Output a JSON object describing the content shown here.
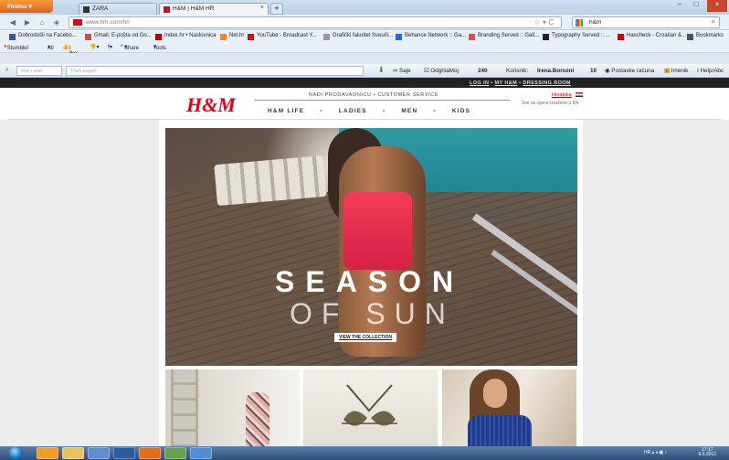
{
  "browser": {
    "menu_label": "Firefox",
    "tabs": [
      {
        "label": "ZARA",
        "active": false
      },
      {
        "label": "H&M | H&M HR",
        "active": true
      }
    ],
    "url": "www.hm.com/hr/",
    "search_text": "h&m"
  },
  "bookmarks": [
    "Dobrodošli na Facebo...",
    "Gmail: E-pošta od Go...",
    "Index.hr • Naslovnica",
    "Net.hr",
    "YouTube - Broadcast Y...",
    "Grafički fakultet Sveuči...",
    "Behance Network :: Ga...",
    "Branding Served :: Gall...",
    "Typography Served :: ...",
    "Hascheck - Croatian &...",
    "Bookmarks"
  ],
  "stumble_bar": {
    "stumble": "Stumble!",
    "all": "All",
    "like": "I like it!",
    "share": "Share",
    "tools": "Tools"
  },
  "toolbar2": {
    "field1_placeholder": "Ime i prez",
    "field2_placeholder": "Traži pojam",
    "saje": "Saje",
    "odghia": "OdghiaMoj",
    "count1": "240",
    "user_label": "Korisnik:",
    "user_name": "Irena.Borozni",
    "count2": "10",
    "account": "Postavke računa",
    "imenik": "Imenik",
    "help": "Help/Abc"
  },
  "hm": {
    "top_links": [
      "LOG IN",
      "MY H&M",
      "DRESSING ROOM"
    ],
    "logo": "H&M",
    "find_store": "NAĐI PRODAVAONICU • CUSTOMER SERVICE",
    "nav": [
      "H&M LIFE",
      "LADIES",
      "MEN",
      "KIDS"
    ],
    "language": "Hrvatska",
    "price_info": "Sve su cijene izražene u KN",
    "hero_title_1": "SEASON",
    "hero_title_2": "OF SUN",
    "hero_cta": "VIEW THE COLLECTION"
  },
  "taskbar": {
    "time": "17:17",
    "date": "9.6.2012"
  }
}
